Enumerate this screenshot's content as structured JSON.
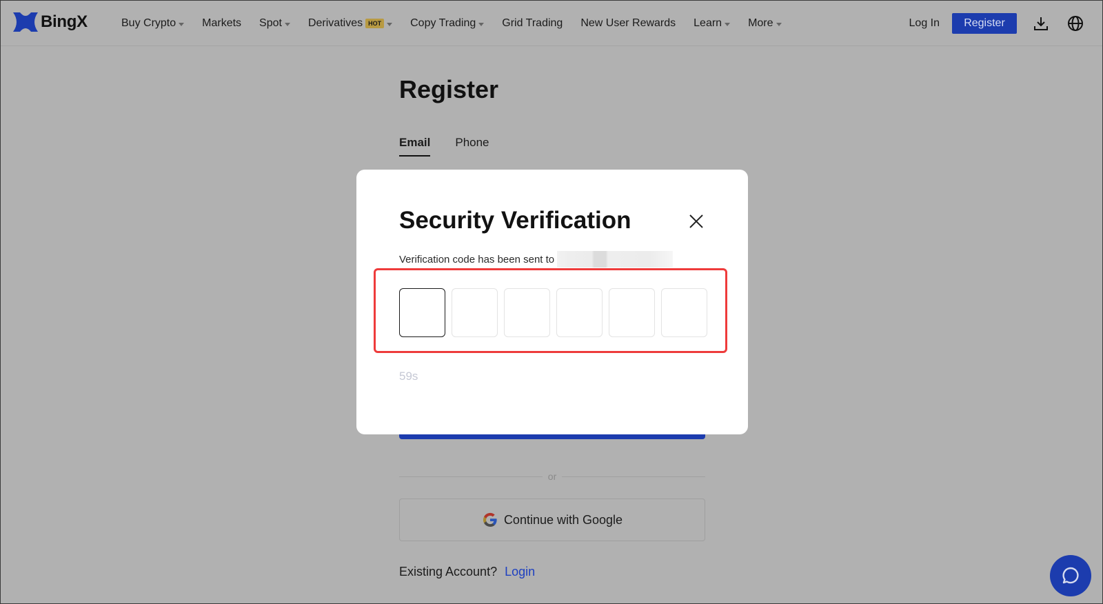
{
  "header": {
    "brand": "BingX",
    "nav": [
      {
        "label": "Buy Crypto",
        "dropdown": true
      },
      {
        "label": "Markets",
        "dropdown": false
      },
      {
        "label": "Spot",
        "dropdown": true
      },
      {
        "label": "Derivatives",
        "badge": "HOT",
        "dropdown": true
      },
      {
        "label": "Copy Trading",
        "dropdown": true
      },
      {
        "label": "Grid Trading",
        "dropdown": false
      },
      {
        "label": "New User Rewards",
        "dropdown": false
      },
      {
        "label": "Learn",
        "dropdown": true
      },
      {
        "label": "More",
        "dropdown": true
      }
    ],
    "login_label": "Log In",
    "register_label": "Register",
    "icons": [
      "download-icon",
      "globe-icon"
    ]
  },
  "page": {
    "title": "Register",
    "tabs": [
      {
        "label": "Email",
        "active": true
      },
      {
        "label": "Phone",
        "active": false
      }
    ],
    "divider_text": "or",
    "google_label": "Continue with Google",
    "existing_account_text": "Existing Account?",
    "login_link": "Login"
  },
  "modal": {
    "title": "Security Verification",
    "sent_text": "Verification code has been sent to",
    "code_length": 6,
    "code_values": [
      "",
      "",
      "",
      "",
      "",
      ""
    ],
    "countdown": "59s"
  },
  "colors": {
    "brand_blue": "#1c3cae",
    "highlight_red": "#ee3b3b",
    "hot_badge": "#b89a42",
    "link_blue": "#1e40c0"
  }
}
